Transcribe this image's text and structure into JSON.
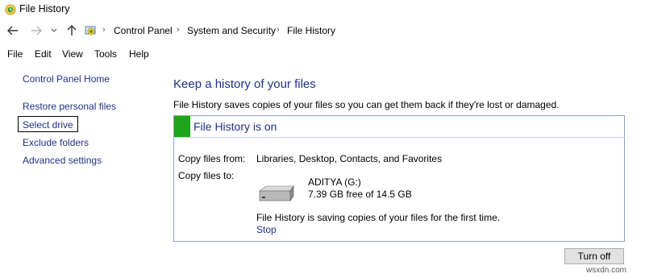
{
  "window": {
    "title": "File History"
  },
  "breadcrumb": [
    "Control Panel",
    "System and Security",
    "File History"
  ],
  "menu": [
    "File",
    "Edit",
    "View",
    "Tools",
    "Help"
  ],
  "sidebar": {
    "home": "Control Panel Home",
    "links": [
      "Restore personal files",
      "Select drive",
      "Exclude folders",
      "Advanced settings"
    ]
  },
  "main": {
    "heading": "Keep a history of your files",
    "description": "File History saves copies of your files so you can get them back if they're lost or damaged.",
    "status": "File History is on",
    "copy_from_label": "Copy files from:",
    "copy_from_value": "Libraries, Desktop, Contacts, and Favorites",
    "copy_to_label": "Copy files to:",
    "drive_name": "ADITYA (G:)",
    "drive_free": "7.39 GB free of 14.5 GB",
    "saving_message": "File History is saving copies of your files for the first time.",
    "stop_label": "Stop",
    "turn_off_label": "Turn off"
  },
  "watermark": "wsxdn.com",
  "colors": {
    "link": "#1e3287",
    "status_on": "#1ea51e",
    "panel_border": "#8a9fd0"
  }
}
